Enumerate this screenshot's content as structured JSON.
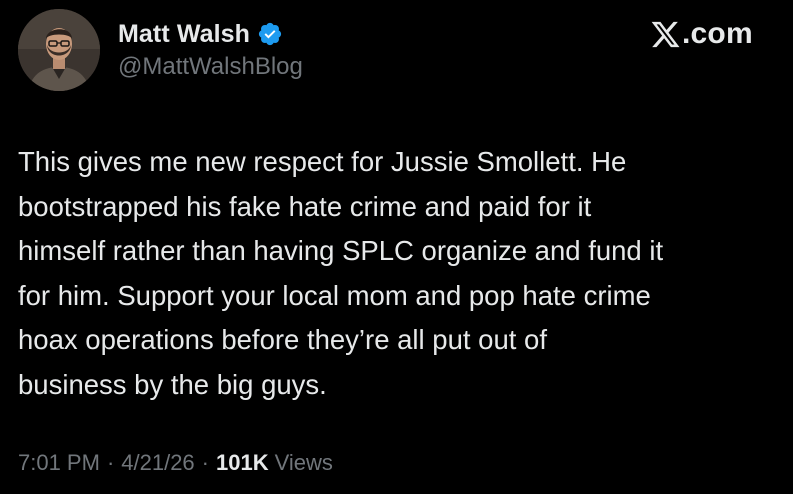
{
  "author": {
    "display_name": "Matt Walsh",
    "handle": "@MattWalshBlog",
    "verified_icon": "verified-badge-icon",
    "avatar": "profile-photo"
  },
  "site": {
    "label": ".com",
    "logo_icon": "x-logo-icon"
  },
  "tweet": {
    "lines": [
      "This gives me new respect for Jussie Smollett. He",
      "bootstrapped his fake hate crime and paid for it",
      "himself rather than having SPLC organize and fund it",
      "for him. Support your local mom and pop hate crime",
      "hoax operations before they’re all put out of",
      "business by the big guys."
    ]
  },
  "meta": {
    "time": "7:01 PM",
    "separator": "·",
    "date": "4/21/26",
    "views_count": "101K",
    "views_label": "Views"
  },
  "colors": {
    "background": "#000000",
    "text": "#e7e9ea",
    "secondary": "#71767b",
    "verified": "#1d9bf0"
  }
}
